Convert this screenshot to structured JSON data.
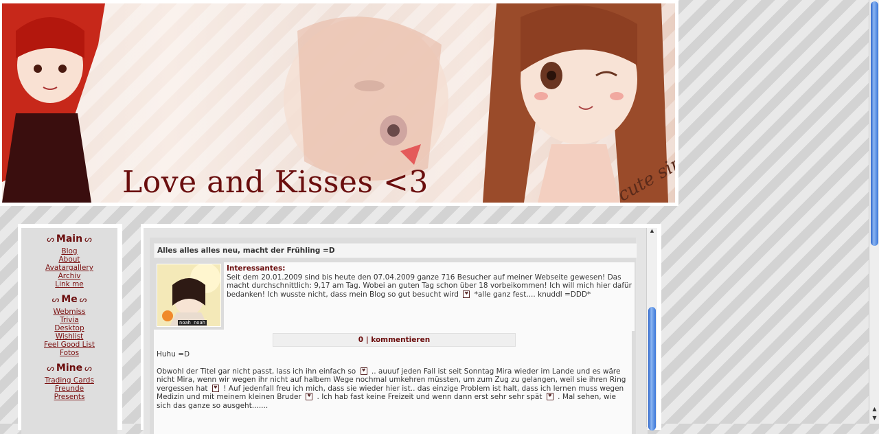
{
  "banner": {
    "title": "Love and Kisses <3",
    "signature": "cute sims"
  },
  "nav": {
    "sections": [
      {
        "heading": "Main",
        "links": [
          "Blog",
          "About",
          "Avatargallery",
          "Archiv",
          "Link me"
        ]
      },
      {
        "heading": "Me",
        "links": [
          "Webmiss",
          "Trivia",
          "Desktop",
          "Wishlist",
          "Feel Good List",
          "Fotos"
        ]
      },
      {
        "heading": "Mine",
        "links": [
          "Trading Cards",
          "Freunde",
          "Presents"
        ]
      }
    ]
  },
  "post": {
    "title": "Alles alles alles neu, macht der Frühling =D",
    "thumb_caption": "noah noah",
    "intro_label": "Interessantes:",
    "intro_text_1": "Seit dem 20.01.2009 sind bis heute den 07.04.2009 ganze 716 Besucher auf meiner Webseite gewesen! Das macht durchschnittlich: 9,17 am Tag. Wobei an guten Tag schon über 18 vorbeikommen! Ich will mich hier dafür bedanken! Ich wusste nicht, dass mein Blog so gut besucht wird",
    "intro_text_2": "*alle ganz fest.... knuddl =DDD*",
    "comments_count": "0",
    "comments_sep": "|",
    "comments_label": "kommentieren",
    "greeting": "Huhu =D",
    "para_1": "Obwohl der Titel gar nicht passt, lass ich ihn einfach so",
    "para_2": ".. auuuf jeden Fall ist seit Sonntag Mira wieder im Lande und es wäre nicht Mira, wenn wir wegen ihr nicht auf halbem Wege nochmal umkehren müssten, um zum Zug zu gelangen, weil sie ihren Ring vergessen hat",
    "para_3": "! Auf jedenfall freu ich mich, dass sie wieder hier ist.. das einzige Problem ist halt, dass ich lernen muss wegen Medizin und mit meinem kleinen Bruder",
    "para_4": ". Ich hab fast keine Freizeit und wenn dann erst sehr sehr spät",
    "para_5": ". Mal sehen, wie sich das ganze so ausgeht......."
  },
  "colors": {
    "accent": "#6b0d0d",
    "scrollbar": "#3b77d8"
  }
}
